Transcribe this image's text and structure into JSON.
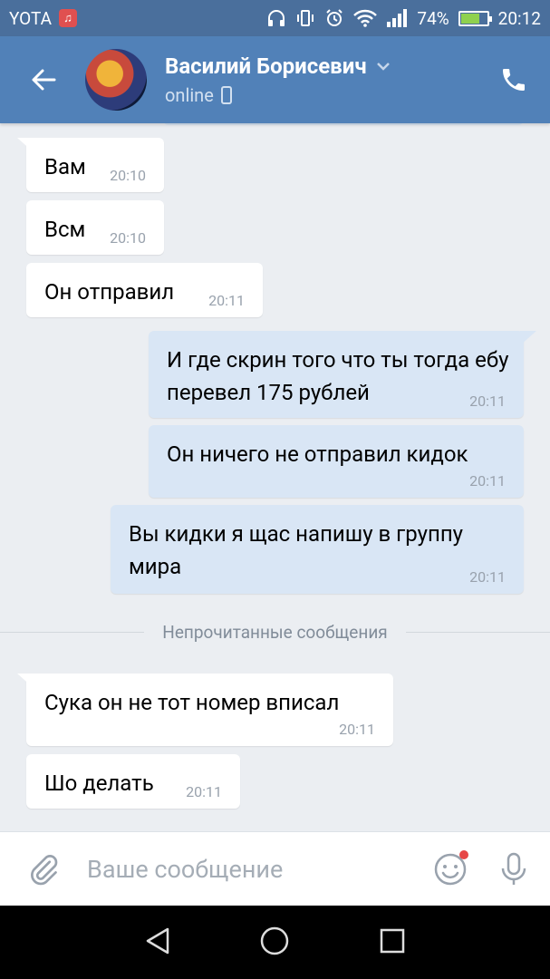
{
  "status_bar": {
    "carrier": "YOTA",
    "battery_percent": "74%",
    "battery_level": 0.74,
    "time": "20:12"
  },
  "header": {
    "contact_name": "Василий Борисевич",
    "status": "online"
  },
  "messages": [
    {
      "direction": "in",
      "text": "Вам",
      "time": "20:10"
    },
    {
      "direction": "in",
      "text": "Всм",
      "time": "20:10"
    },
    {
      "direction": "in",
      "text": "Он отправил",
      "time": "20:11"
    },
    {
      "direction": "out",
      "text": "И где скрин того что ты тогда ебу перевел 175 рублей",
      "time": "20:11"
    },
    {
      "direction": "out",
      "text": "Он ничего не отправил кидок",
      "time": "20:11"
    },
    {
      "direction": "out",
      "text": "Вы кидки я щас напишу в группу мира",
      "time": "20:11"
    },
    {
      "direction": "in",
      "text": "Сука он не тот номер вписал",
      "time": "20:11"
    },
    {
      "direction": "in",
      "text": "Шо делать",
      "time": "20:11"
    }
  ],
  "unread_divider": "Непрочитанные сообщения",
  "composer": {
    "placeholder": "Ваше сообщение"
  },
  "colors": {
    "header": "#5181b8",
    "status_bar": "#4a6f9c",
    "outgoing_bubble": "#d9e6f5",
    "incoming_bubble": "#ffffff",
    "background": "#ebeef2"
  }
}
